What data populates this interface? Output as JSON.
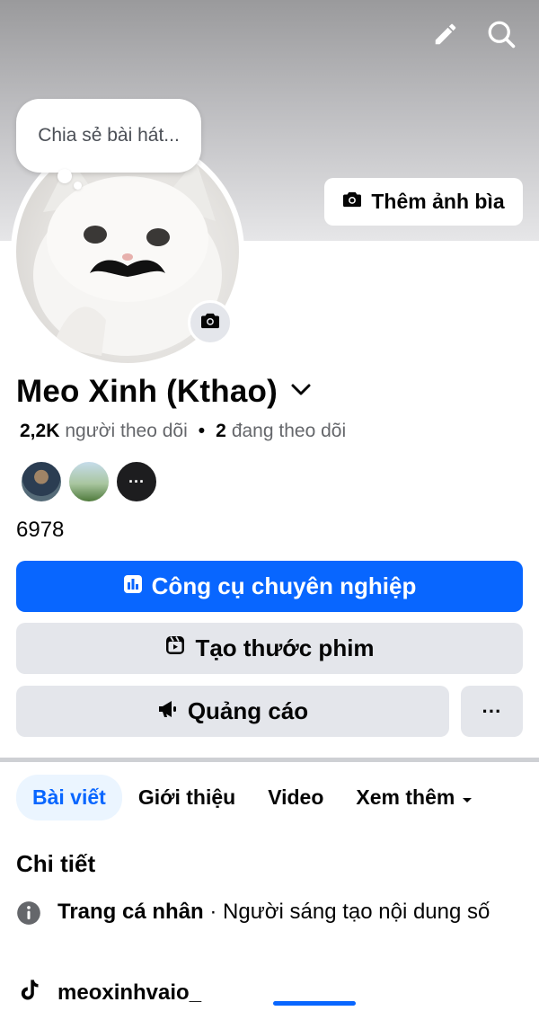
{
  "header": {
    "edit_icon": "pencil-icon",
    "search_icon": "search-icon"
  },
  "cover": {
    "add_cover_label": "Thêm ảnh bìa"
  },
  "note_bubble": {
    "placeholder": "Chia sẻ bài hát..."
  },
  "profile": {
    "name": "Meo Xinh (Kthao)",
    "followers_count": "2,2K",
    "followers_label": "người theo dõi",
    "following_count": "2",
    "following_label": "đang theo dõi",
    "more_friends": "···",
    "number": "6978"
  },
  "actions": {
    "professional_tools": "Công cụ chuyên nghiệp",
    "create_reel": "Tạo thước phim",
    "ads": "Quảng cáo",
    "more": "···"
  },
  "tabs": [
    {
      "label": "Bài viết",
      "active": true
    },
    {
      "label": "Giới thiệu",
      "active": false
    },
    {
      "label": "Video",
      "active": false
    },
    {
      "label": "Xem thêm",
      "active": false
    }
  ],
  "details": {
    "title": "Chi tiết",
    "page_type_bold": "Trang cá nhân",
    "page_type_rest": " · Người sáng tạo nội dung số",
    "tiktok": "meoxinhvaio_"
  },
  "colors": {
    "accent": "#0866ff",
    "secondary_button": "#e4e6eb"
  }
}
